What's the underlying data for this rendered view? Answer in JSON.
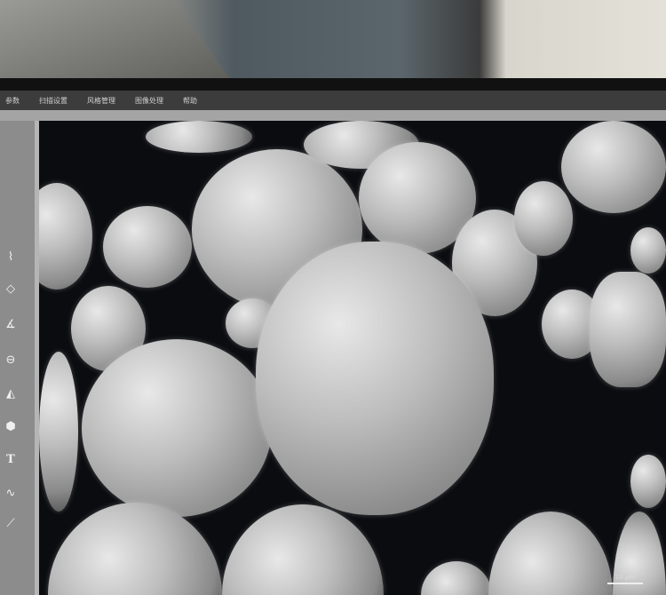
{
  "menu": {
    "items": [
      "参数",
      "扫描设置",
      "风格管理",
      "图像处理",
      "帮助"
    ]
  },
  "toolbar": {
    "tools": [
      "line-tool",
      "polygon-tool",
      "angle-tool",
      "circle-tool",
      "area-angle-tool",
      "shape-tool",
      "text-tool",
      "waveform-tool",
      "arrow-tool"
    ],
    "text_glyph": "T"
  },
  "viewer": {
    "scale_label": "10 μm"
  }
}
